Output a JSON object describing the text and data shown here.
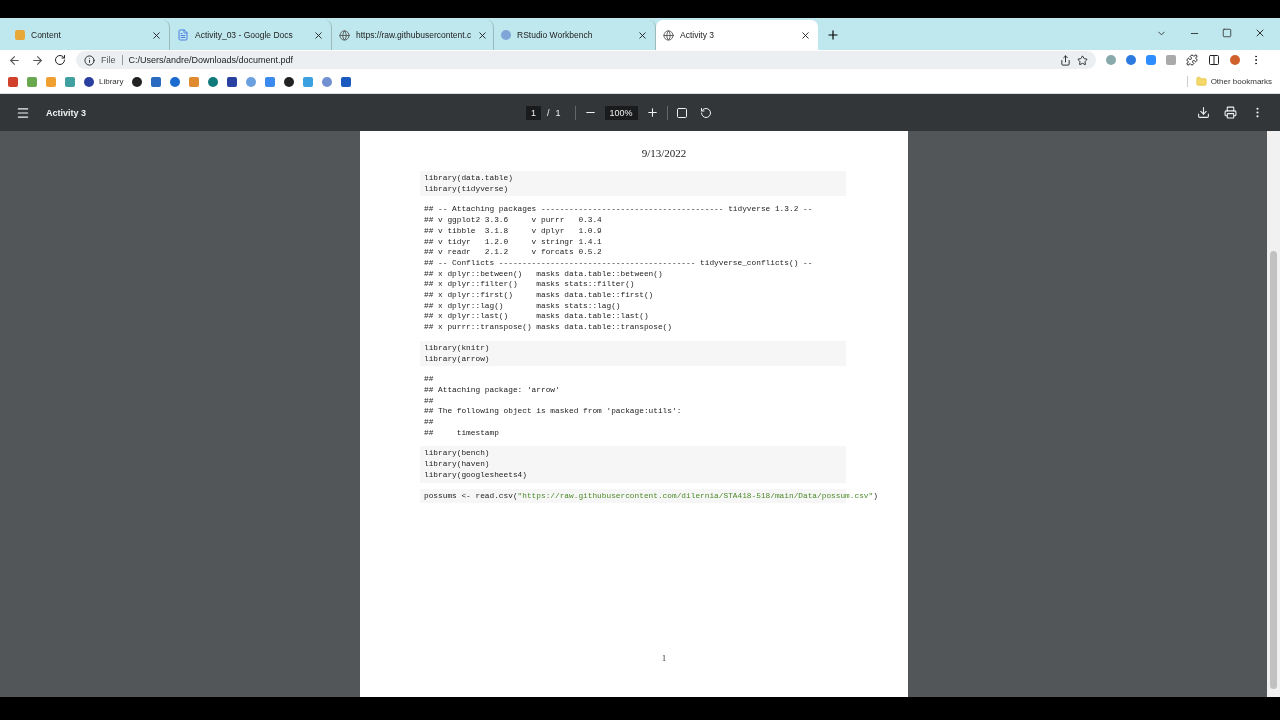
{
  "tabs": [
    {
      "title": "Content",
      "kind": "pencil",
      "selected": false
    },
    {
      "title": "Activity_03 - Google Docs",
      "kind": "doc",
      "selected": false
    },
    {
      "title": "https://raw.githubusercontent.c",
      "kind": "globe",
      "selected": false
    },
    {
      "title": "RStudio Workbench",
      "kind": "circle",
      "selected": false
    },
    {
      "title": "Activity 3",
      "kind": "globe",
      "selected": true
    }
  ],
  "address_bar": {
    "scheme": "File",
    "url": "C:/Users/andre/Downloads/document.pdf"
  },
  "bookmarks": {
    "library_label": "Library",
    "other": "Other bookmarks"
  },
  "pdf_toolbar": {
    "title": "Activity 3",
    "page": "1",
    "page_sep": "/",
    "page_count": "1",
    "zoom": "100%"
  },
  "document": {
    "date": "9/13/2022",
    "page_number": "1",
    "blocks": [
      {
        "kind": "code",
        "lines": [
          [
            {
              "kind": "plain",
              "text": "library(data.table)"
            }
          ],
          [
            {
              "kind": "plain",
              "text": "library(tidyverse)"
            }
          ]
        ]
      },
      {
        "kind": "output",
        "lines": [
          [
            {
              "kind": "plain",
              "text": "## -- Attaching packages --------------------------------------- tidyverse 1.3.2 --"
            }
          ],
          [
            {
              "kind": "plain",
              "text": "## v ggplot2 3.3.6     v purrr   0.3.4"
            }
          ],
          [
            {
              "kind": "plain",
              "text": "## v tibble  3.1.8     v dplyr   1.0.9"
            }
          ],
          [
            {
              "kind": "plain",
              "text": "## v tidyr   1.2.0     v stringr 1.4.1"
            }
          ],
          [
            {
              "kind": "plain",
              "text": "## v readr   2.1.2     v forcats 0.5.2"
            }
          ],
          [
            {
              "kind": "plain",
              "text": "## -- Conflicts ------------------------------------------ tidyverse_conflicts() --"
            }
          ],
          [
            {
              "kind": "plain",
              "text": "## x dplyr::between()   masks data.table::between()"
            }
          ],
          [
            {
              "kind": "plain",
              "text": "## x dplyr::filter()    masks stats::filter()"
            }
          ],
          [
            {
              "kind": "plain",
              "text": "## x dplyr::first()     masks data.table::first()"
            }
          ],
          [
            {
              "kind": "plain",
              "text": "## x dplyr::lag()       masks stats::lag()"
            }
          ],
          [
            {
              "kind": "plain",
              "text": "## x dplyr::last()      masks data.table::last()"
            }
          ],
          [
            {
              "kind": "plain",
              "text": "## x purrr::transpose() masks data.table::transpose()"
            }
          ]
        ]
      },
      {
        "kind": "code",
        "lines": [
          [
            {
              "kind": "plain",
              "text": "library(knitr)"
            }
          ],
          [
            {
              "kind": "plain",
              "text": "library(arrow)"
            }
          ]
        ]
      },
      {
        "kind": "output",
        "lines": [
          [
            {
              "kind": "plain",
              "text": "##"
            }
          ],
          [
            {
              "kind": "plain",
              "text": "## Attaching package: 'arrow'"
            }
          ],
          [
            {
              "kind": "plain",
              "text": "##"
            }
          ],
          [
            {
              "kind": "plain",
              "text": "## The following object is masked from 'package:utils':"
            }
          ],
          [
            {
              "kind": "plain",
              "text": "##"
            }
          ],
          [
            {
              "kind": "plain",
              "text": "##     timestamp"
            }
          ]
        ]
      },
      {
        "kind": "code",
        "lines": [
          [
            {
              "kind": "plain",
              "text": "library(bench)"
            }
          ],
          [
            {
              "kind": "plain",
              "text": "library(haven)"
            }
          ],
          [
            {
              "kind": "plain",
              "text": "library(googlesheets4)"
            }
          ]
        ]
      },
      {
        "kind": "code",
        "lines": [
          [
            {
              "kind": "plain",
              "text": "possums <- read.csv("
            },
            {
              "kind": "string",
              "text": "\"https://raw.githubusercontent.com/dilernia/STA418-518/main/Data/possum.csv\""
            },
            {
              "kind": "plain",
              "text": ")"
            }
          ]
        ]
      }
    ]
  }
}
